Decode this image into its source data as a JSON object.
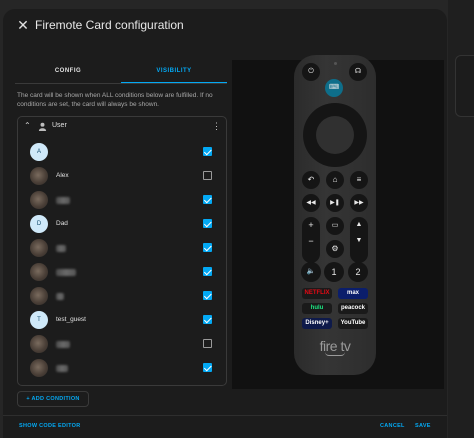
{
  "dialog": {
    "title": "Firemote Card configuration"
  },
  "tabs": [
    {
      "label": "CONFIG"
    },
    {
      "label": "VISIBILITY"
    }
  ],
  "description": "The card will be shown when ALL conditions below are fulfilled. If no conditions are set, the card will always be shown.",
  "condition": {
    "title": "User",
    "users": [
      {
        "initial": "A",
        "name": "",
        "checked": true,
        "avatar": "letter"
      },
      {
        "initial": "",
        "name": "Alex",
        "checked": false,
        "avatar": "photo"
      },
      {
        "initial": "",
        "name": "",
        "checked": true,
        "avatar": "photo"
      },
      {
        "initial": "D",
        "name": "Dad",
        "checked": true,
        "avatar": "letter"
      },
      {
        "initial": "",
        "name": "",
        "checked": true,
        "avatar": "photo"
      },
      {
        "initial": "",
        "name": "",
        "checked": true,
        "avatar": "photo"
      },
      {
        "initial": "",
        "name": "",
        "checked": true,
        "avatar": "photo"
      },
      {
        "initial": "T",
        "name": "test_guest",
        "checked": true,
        "avatar": "letter"
      },
      {
        "initial": "",
        "name": "",
        "checked": false,
        "avatar": "photo"
      },
      {
        "initial": "",
        "name": "",
        "checked": true,
        "avatar": "photo"
      }
    ]
  },
  "add_condition_label": "+ ADD CONDITION",
  "footer": {
    "show_code": "SHOW CODE EDITOR",
    "cancel": "CANCEL",
    "save": "SAVE"
  },
  "remote": {
    "brand": "fire tv",
    "apps": [
      {
        "label": "NETFLIX",
        "bg": "#1a1a1a",
        "color": "#e50914"
      },
      {
        "label": "max",
        "bg": "#0b1e6b",
        "color": "#ffffff"
      },
      {
        "label": "hulu",
        "bg": "#1a1a1a",
        "color": "#1ce783"
      },
      {
        "label": "peacock",
        "bg": "#1a1a1a",
        "color": "#ffffff"
      },
      {
        "label": "Disney+",
        "bg": "#0e1a4a",
        "color": "#ffffff"
      },
      {
        "label": "YouTube",
        "bg": "#1a1a1a",
        "color": "#ffffff"
      }
    ]
  },
  "colors": {
    "accent": "#03a9f4"
  }
}
